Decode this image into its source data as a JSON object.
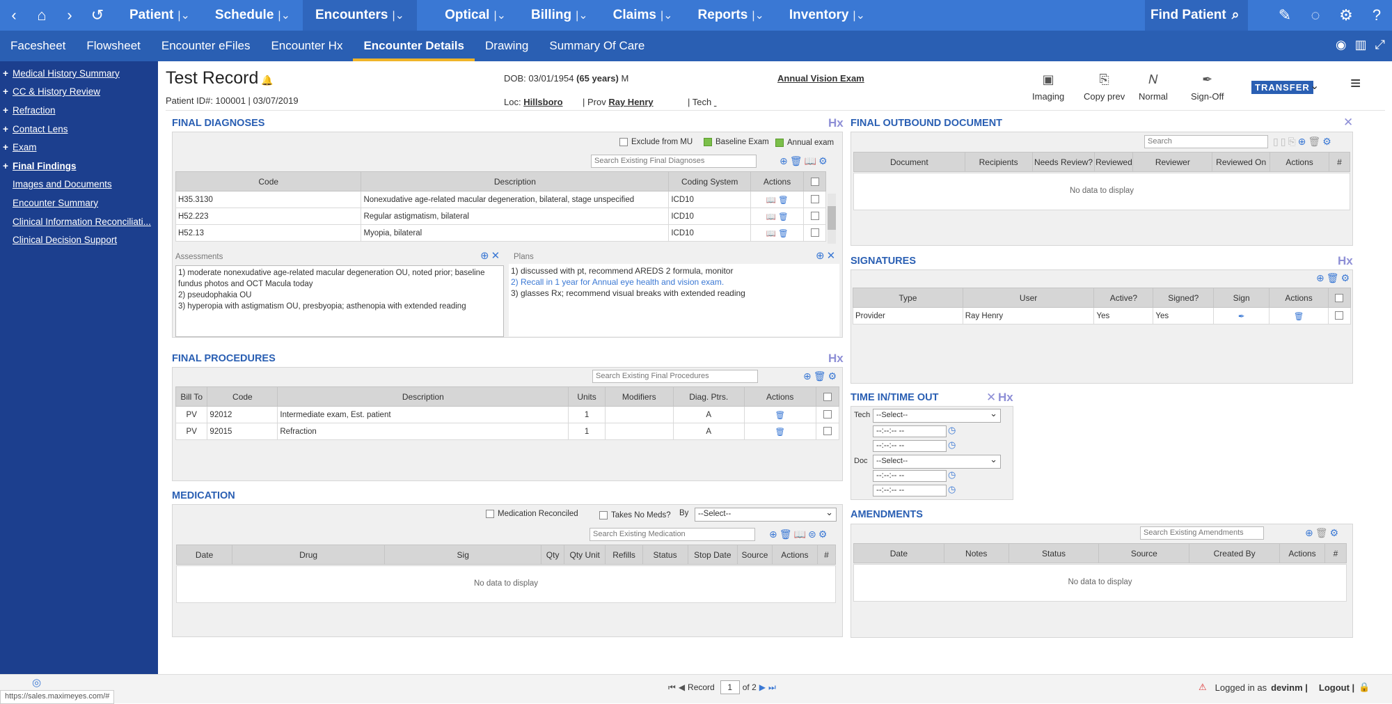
{
  "topnav": {
    "menus": [
      "Patient",
      "Schedule",
      "Encounters",
      "Optical",
      "Billing",
      "Claims",
      "Reports",
      "Inventory"
    ],
    "active": "Encounters",
    "find_patient": "Find Patient",
    "icons": [
      "back-icon",
      "home-icon",
      "forward-icon",
      "history-icon",
      "search-icon",
      "edit-icon",
      "chat-icon",
      "gear-icon",
      "help-icon"
    ]
  },
  "subnav": {
    "tabs": [
      "Facesheet",
      "Flowsheet",
      "Encounter eFiles",
      "Encounter Hx",
      "Encounter Details",
      "Drawing",
      "Summary Of Care"
    ],
    "active": "Encounter Details"
  },
  "sidebar": {
    "items": [
      {
        "label": "Medical History Summary",
        "plus": "+"
      },
      {
        "label": "CC & History Review",
        "plus": "+"
      },
      {
        "label": "Refraction",
        "plus": "+"
      },
      {
        "label": "Contact Lens",
        "plus": "+"
      },
      {
        "label": "Exam",
        "plus": "+"
      },
      {
        "label": "Final Findings",
        "plus": "+"
      },
      {
        "label": "Images and Documents",
        "plus": ""
      },
      {
        "label": "Encounter Summary",
        "plus": ""
      },
      {
        "label": "Clinical Information Reconciliati...",
        "plus": ""
      },
      {
        "label": "Clinical Decision Support",
        "plus": ""
      }
    ]
  },
  "patient": {
    "name": "Test Record",
    "id_line": "Patient ID#: 100001 | 03/07/2019",
    "dob_label": "DOB: 03/01/1954",
    "age": "(65 years)",
    "sex": "M",
    "loc_label": "Loc:",
    "loc": "Hillsboro",
    "prov_label": "| Prov",
    "prov": "Ray Henry",
    "tech_label": "| Tech",
    "visit": "Annual Vision Exam"
  },
  "toolbar": {
    "imaging": "Imaging",
    "copy_prev": "Copy prev",
    "normal": "Normal",
    "sign_off": "Sign-Off",
    "transfer": "TRANSFER"
  },
  "hx": "Hx",
  "final_diagnoses": {
    "title": "FINAL DIAGNOSES",
    "exclude_mu": "Exclude from MU",
    "baseline": "Baseline Exam",
    "annual": "Annual exam",
    "search_placeholder": "Search Existing Final Diagnoses",
    "columns": [
      "Code",
      "Description",
      "Coding System",
      "Actions"
    ],
    "rows": [
      {
        "code": "H35.3130",
        "description": "Nonexudative age-related macular degeneration, bilateral, stage unspecified",
        "system": "ICD10"
      },
      {
        "code": "H52.223",
        "description": "Regular astigmatism, bilateral",
        "system": "ICD10"
      },
      {
        "code": "H52.13",
        "description": "Myopia, bilateral",
        "system": "ICD10"
      }
    ],
    "assessments_label": "Assessments",
    "assessments": [
      "1) moderate nonexudative age-related macular degeneration OU, noted prior; baseline fundus photos and OCT Macula today",
      "2) pseudophakia OU",
      "3) hyperopia with astigmatism OU, presbyopia; asthenopia with extended reading"
    ],
    "plans_label": "Plans",
    "plans": [
      "1) discussed with pt, recommend AREDS 2 formula, monitor",
      "2) Recall in 1 year for Annual eye health and vision exam.",
      "3) glasses Rx; recommend visual breaks with extended reading"
    ]
  },
  "final_procedures": {
    "title": "FINAL PROCEDURES",
    "search_placeholder": "Search Existing Final Procedures",
    "columns": [
      "Bill To",
      "Code",
      "Description",
      "Units",
      "Modifiers",
      "Diag. Ptrs.",
      "Actions"
    ],
    "rows": [
      {
        "bill_to": "PV",
        "code": "92012",
        "description": "Intermediate exam, Est. patient",
        "units": "1",
        "modifiers": "",
        "diag": "A"
      },
      {
        "bill_to": "PV",
        "code": "92015",
        "description": "Refraction",
        "units": "1",
        "modifiers": "",
        "diag": "A"
      }
    ]
  },
  "medication": {
    "title": "MEDICATION",
    "reconciled": "Medication Reconciled",
    "no_meds": "Takes No Meds?",
    "by": "By",
    "by_select": "--Select--",
    "search_placeholder": "Search Existing Medication",
    "columns": [
      "Date",
      "Drug",
      "Sig",
      "Qty",
      "Qty Unit",
      "Refills",
      "Status",
      "Stop Date",
      "Source",
      "Actions",
      "#"
    ],
    "empty": "No data to display"
  },
  "outbound": {
    "title": "FINAL OUTBOUND DOCUMENT",
    "search_placeholder": "Search",
    "columns": [
      "Document",
      "Recipients",
      "Needs Review?",
      "Reviewed",
      "Reviewer",
      "Reviewed On",
      "Actions",
      "#"
    ],
    "empty": "No data to display"
  },
  "signatures": {
    "title": "SIGNATURES",
    "columns": [
      "Type",
      "User",
      "Active?",
      "Signed?",
      "Sign",
      "Actions"
    ],
    "rows": [
      {
        "type": "Provider",
        "user": "Ray Henry",
        "active": "Yes",
        "signed": "Yes"
      }
    ]
  },
  "time": {
    "title": "TIME IN/TIME OUT",
    "tech": "Tech",
    "doc": "Doc",
    "select": "--Select--",
    "time_placeholder": "--:--:-- --"
  },
  "amendments": {
    "title": "AMENDMENTS",
    "search_placeholder": "Search Existing Amendments",
    "columns": [
      "Date",
      "Notes",
      "Status",
      "Source",
      "Created By",
      "Actions",
      "#"
    ],
    "empty": "No data to display"
  },
  "footer": {
    "url": "https://sales.maximeyes.com/#",
    "record_label": "Record",
    "page": "1",
    "of": "of 2",
    "logged_in": "Logged in as",
    "user": "devinm |",
    "logout": "Logout |"
  }
}
